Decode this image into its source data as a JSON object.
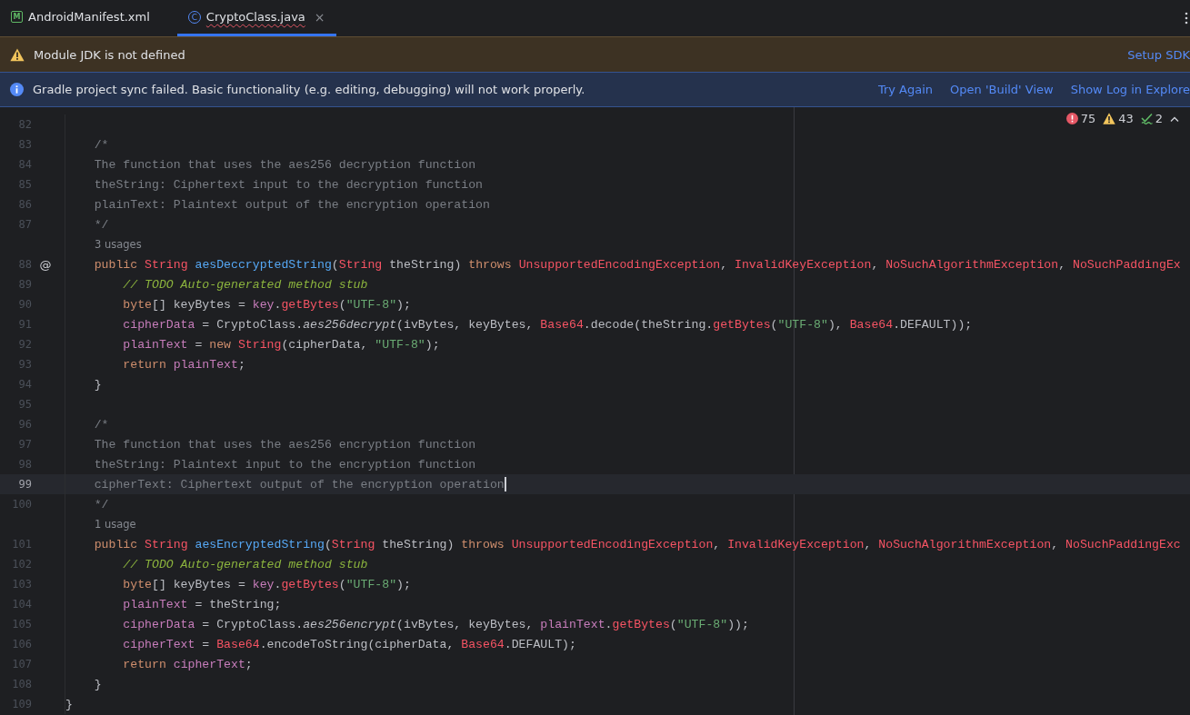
{
  "tabs": [
    {
      "label": "AndroidManifest.xml",
      "icon": "M",
      "kind": "xml",
      "selected": false,
      "has_error": false
    },
    {
      "label": "CryptoClass.java",
      "icon": "C",
      "kind": "class",
      "selected": true,
      "has_error": true,
      "close": "×"
    }
  ],
  "banners": [
    {
      "kind": "warning",
      "message": "Module JDK is not defined",
      "links": [
        "Setup SDK"
      ]
    },
    {
      "kind": "info",
      "message": "Gradle project sync failed. Basic functionality (e.g. editing, debugging) will not work properly.",
      "links": [
        "Try Again",
        "Open 'Build' View",
        "Show Log in Explore"
      ]
    }
  ],
  "inspections": {
    "errors": "75",
    "warnings": "43",
    "typos": "2"
  },
  "lines": [
    {
      "kind": "code",
      "number": "82",
      "current": false
    },
    {
      "kind": "code",
      "number": "83",
      "current": false,
      "tokens": [
        {
          "kind": "c",
          "text": "    /*"
        }
      ]
    },
    {
      "kind": "code",
      "number": "84",
      "current": false,
      "tokens": [
        {
          "kind": "c",
          "text": "    The function that uses the aes256 decryption function"
        }
      ]
    },
    {
      "kind": "code",
      "number": "85",
      "current": false,
      "tokens": [
        {
          "kind": "c",
          "text": "    theString: Ciphertext input to the decryption function"
        }
      ]
    },
    {
      "kind": "code",
      "number": "86",
      "current": false,
      "tokens": [
        {
          "kind": "c",
          "text": "    plainText: Plaintext output of the encryption operation"
        }
      ]
    },
    {
      "kind": "code",
      "number": "87",
      "current": false,
      "tokens": [
        {
          "kind": "c",
          "text": "    */"
        }
      ]
    },
    {
      "kind": "hint",
      "text": "3 usages"
    },
    {
      "kind": "code",
      "number": "88",
      "current": false,
      "gutter": "@",
      "tokens": [
        {
          "kind": "kw",
          "text": "    public "
        },
        {
          "kind": "err",
          "text": "String "
        },
        {
          "kind": "fn",
          "text": "aesDeccryptedString"
        },
        {
          "kind": "p",
          "text": "("
        },
        {
          "kind": "err",
          "text": "String"
        },
        {
          "kind": "p",
          "text": " theString) "
        },
        {
          "kind": "kw",
          "text": "throws "
        },
        {
          "kind": "err",
          "text": "UnsupportedEncodingException"
        },
        {
          "kind": "p",
          "text": ", "
        },
        {
          "kind": "err",
          "text": "InvalidKeyException"
        },
        {
          "kind": "p",
          "text": ", "
        },
        {
          "kind": "err",
          "text": "NoSuchAlgorithmException"
        },
        {
          "kind": "p",
          "text": ", "
        },
        {
          "kind": "err",
          "text": "NoSuchPaddingEx"
        }
      ]
    },
    {
      "kind": "code",
      "number": "89",
      "current": false,
      "tokens": [
        {
          "kind": "todo",
          "text": "        // TODO Auto-generated method stub"
        }
      ]
    },
    {
      "kind": "code",
      "number": "90",
      "current": false,
      "tokens": [
        {
          "kind": "kw",
          "text": "        byte"
        },
        {
          "kind": "p",
          "text": "[] keyBytes = "
        },
        {
          "kind": "mem",
          "text": "key"
        },
        {
          "kind": "p",
          "text": "."
        },
        {
          "kind": "err",
          "text": "getBytes"
        },
        {
          "kind": "p",
          "text": "("
        },
        {
          "kind": "str",
          "text": "\"UTF-8\""
        },
        {
          "kind": "p",
          "text": ");"
        }
      ]
    },
    {
      "kind": "code",
      "number": "91",
      "current": false,
      "tokens": [
        {
          "kind": "mem",
          "text": "        cipherData"
        },
        {
          "kind": "p",
          "text": " = CryptoClass."
        },
        {
          "kind": "it",
          "text": "aes256decrypt"
        },
        {
          "kind": "p",
          "text": "(ivBytes, keyBytes, "
        },
        {
          "kind": "err",
          "text": "Base64"
        },
        {
          "kind": "p",
          "text": ".decode(theString."
        },
        {
          "kind": "err",
          "text": "getBytes"
        },
        {
          "kind": "p",
          "text": "("
        },
        {
          "kind": "str",
          "text": "\"UTF-8\""
        },
        {
          "kind": "p",
          "text": "), "
        },
        {
          "kind": "err",
          "text": "Base64"
        },
        {
          "kind": "p",
          "text": ".DEFAULT));"
        }
      ]
    },
    {
      "kind": "code",
      "number": "92",
      "current": false,
      "tokens": [
        {
          "kind": "mem",
          "text": "        plainText"
        },
        {
          "kind": "p",
          "text": " = "
        },
        {
          "kind": "kw",
          "text": "new "
        },
        {
          "kind": "err",
          "text": "String"
        },
        {
          "kind": "p",
          "text": "(cipherData, "
        },
        {
          "kind": "str",
          "text": "\"UTF-8\""
        },
        {
          "kind": "p",
          "text": ");"
        }
      ]
    },
    {
      "kind": "code",
      "number": "93",
      "current": false,
      "tokens": [
        {
          "kind": "kw",
          "text": "        return "
        },
        {
          "kind": "mem",
          "text": "plainText"
        },
        {
          "kind": "p",
          "text": ";"
        }
      ]
    },
    {
      "kind": "code",
      "number": "94",
      "current": false,
      "tokens": [
        {
          "kind": "p",
          "text": "    }"
        }
      ]
    },
    {
      "kind": "code",
      "number": "95",
      "current": false
    },
    {
      "kind": "code",
      "number": "96",
      "current": false,
      "tokens": [
        {
          "kind": "c",
          "text": "    /*"
        }
      ]
    },
    {
      "kind": "code",
      "number": "97",
      "current": false,
      "tokens": [
        {
          "kind": "c",
          "text": "    The function that uses the aes256 encryption function"
        }
      ]
    },
    {
      "kind": "code",
      "number": "98",
      "current": false,
      "tokens": [
        {
          "kind": "c",
          "text": "    theString: Plaintext input to the encryption function"
        }
      ]
    },
    {
      "kind": "code",
      "number": "99",
      "current": true,
      "tokens": [
        {
          "kind": "c",
          "text": "    cipherText: Ciphertext output of the encryption operation"
        }
      ]
    },
    {
      "kind": "code",
      "number": "100",
      "current": false,
      "tokens": [
        {
          "kind": "c",
          "text": "    */"
        }
      ]
    },
    {
      "kind": "hint",
      "text": "1 usage"
    },
    {
      "kind": "code",
      "number": "101",
      "current": false,
      "tokens": [
        {
          "kind": "kw",
          "text": "    public "
        },
        {
          "kind": "err",
          "text": "String "
        },
        {
          "kind": "fn",
          "text": "aesEncryptedString"
        },
        {
          "kind": "p",
          "text": "("
        },
        {
          "kind": "err",
          "text": "String"
        },
        {
          "kind": "p",
          "text": " theString) "
        },
        {
          "kind": "kw",
          "text": "throws "
        },
        {
          "kind": "err",
          "text": "UnsupportedEncodingException"
        },
        {
          "kind": "p",
          "text": ", "
        },
        {
          "kind": "err",
          "text": "InvalidKeyException"
        },
        {
          "kind": "p",
          "text": ", "
        },
        {
          "kind": "err",
          "text": "NoSuchAlgorithmException"
        },
        {
          "kind": "p",
          "text": ", "
        },
        {
          "kind": "err",
          "text": "NoSuchPaddingExc"
        }
      ]
    },
    {
      "kind": "code",
      "number": "102",
      "current": false,
      "tokens": [
        {
          "kind": "todo",
          "text": "        // TODO Auto-generated method stub"
        }
      ]
    },
    {
      "kind": "code",
      "number": "103",
      "current": false,
      "tokens": [
        {
          "kind": "kw",
          "text": "        byte"
        },
        {
          "kind": "p",
          "text": "[] keyBytes = "
        },
        {
          "kind": "mem",
          "text": "key"
        },
        {
          "kind": "p",
          "text": "."
        },
        {
          "kind": "err",
          "text": "getBytes"
        },
        {
          "kind": "p",
          "text": "("
        },
        {
          "kind": "str",
          "text": "\"UTF-8\""
        },
        {
          "kind": "p",
          "text": ");"
        }
      ]
    },
    {
      "kind": "code",
      "number": "104",
      "current": false,
      "tokens": [
        {
          "kind": "mem",
          "text": "        plainText"
        },
        {
          "kind": "p",
          "text": " = theString;"
        }
      ]
    },
    {
      "kind": "code",
      "number": "105",
      "current": false,
      "tokens": [
        {
          "kind": "mem",
          "text": "        cipherData"
        },
        {
          "kind": "p",
          "text": " = CryptoClass."
        },
        {
          "kind": "it",
          "text": "aes256encrypt"
        },
        {
          "kind": "p",
          "text": "(ivBytes, keyBytes, "
        },
        {
          "kind": "mem",
          "text": "plainText"
        },
        {
          "kind": "p",
          "text": "."
        },
        {
          "kind": "err",
          "text": "getBytes"
        },
        {
          "kind": "p",
          "text": "("
        },
        {
          "kind": "str",
          "text": "\"UTF-8\""
        },
        {
          "kind": "p",
          "text": "));"
        }
      ]
    },
    {
      "kind": "code",
      "number": "106",
      "current": false,
      "tokens": [
        {
          "kind": "mem",
          "text": "        cipherText"
        },
        {
          "kind": "p",
          "text": " = "
        },
        {
          "kind": "err",
          "text": "Base64"
        },
        {
          "kind": "p",
          "text": ".encodeToString(cipherData, "
        },
        {
          "kind": "err",
          "text": "Base64"
        },
        {
          "kind": "p",
          "text": ".DEFAULT);"
        }
      ]
    },
    {
      "kind": "code",
      "number": "107",
      "current": false,
      "tokens": [
        {
          "kind": "kw",
          "text": "        return "
        },
        {
          "kind": "mem",
          "text": "cipherText"
        },
        {
          "kind": "p",
          "text": ";"
        }
      ]
    },
    {
      "kind": "code",
      "number": "108",
      "current": false,
      "tokens": [
        {
          "kind": "p",
          "text": "    }"
        }
      ]
    },
    {
      "kind": "code",
      "number": "109",
      "current": false,
      "tokens": [
        {
          "kind": "p",
          "text": "}"
        }
      ]
    }
  ]
}
